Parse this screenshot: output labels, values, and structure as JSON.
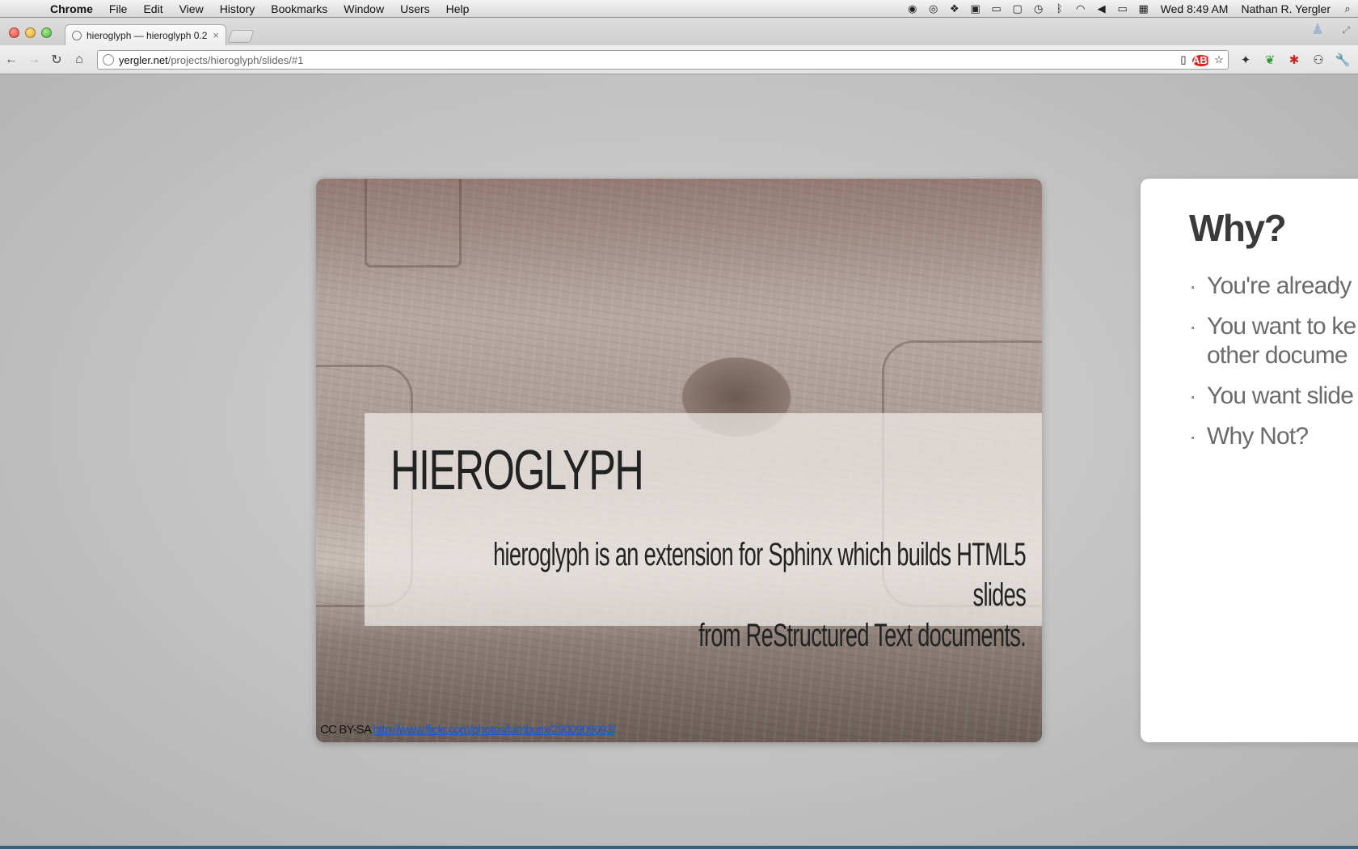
{
  "menubar": {
    "apple_glyph": "",
    "items": [
      "Chrome",
      "File",
      "Edit",
      "View",
      "History",
      "Bookmarks",
      "Window",
      "Users",
      "Help"
    ],
    "clock": "Wed 8:49 AM",
    "user": "Nathan R. Yergler",
    "status_icons": [
      "app-status-icon",
      "eye-icon",
      "dropbox-icon",
      "clipboard-icon",
      "battery-mini-icon",
      "display-icon",
      "time-machine-icon",
      "bluetooth-icon",
      "wifi-icon",
      "volume-icon",
      "battery-icon",
      "calendar-icon"
    ]
  },
  "browser": {
    "tab": {
      "title": "hieroglyph — hieroglyph 0.2",
      "close": "×"
    },
    "omnibox": {
      "host": "yergler.net",
      "path": "/projects/hieroglyph/slides/#1"
    }
  },
  "slide1": {
    "title": "HIEROGLYPH",
    "subtitle": "HIEROGLYPH IS AN EXTENSION FOR SPHINX WHICH BUILDS HTML5 SLIDES FROM RESTRUCTURED TEXT DOCUMENTS.",
    "subtitle_line1": "hieroglyph is an extension for Sphinx which builds HTML5 slides",
    "subtitle_line2": "from ReStructured Text documents.",
    "credit_prefix": "CC BY-SA",
    "credit_link": "http://www.flickr.com/photos/tamburix/2900909093/"
  },
  "slide2": {
    "title": "Why?",
    "bullets": [
      "You're already",
      "You want to ke​other docume",
      "You want slide",
      "Why Not?"
    ],
    "bullet2_line1": "You want to ke",
    "bullet2_line2": "other docume"
  }
}
